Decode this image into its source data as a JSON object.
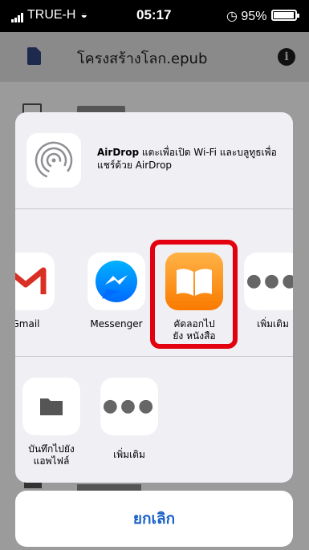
{
  "status_bar": {
    "carrier": "TRUE-H",
    "time": "05:17",
    "battery_percent": "95%",
    "battery_level": 0.95
  },
  "header": {
    "title": "โครงสร้างโลก.epub"
  },
  "airdrop": {
    "name": "AirDrop",
    "description": "แตะเพื่อเปิด Wi-Fi และบลูทูธเพื่อแชร์ด้วย AirDrop"
  },
  "share_apps": [
    {
      "label": "Gmail",
      "icon": "gmail-icon"
    },
    {
      "label": "Messenger",
      "icon": "messenger-icon"
    },
    {
      "label": "คัดลอกไปยัง หนังสือ",
      "label_line1": "คัดลอกไป",
      "label_line2": "ยัง หนังสือ",
      "icon": "books-icon"
    },
    {
      "label": "เพิ่มเติม",
      "icon": "more-icon"
    }
  ],
  "actions": [
    {
      "label_line1": "บันทึกไปยัง",
      "label_line2": "แอพไฟล์",
      "icon": "files-folder-icon"
    },
    {
      "label": "เพิ่มเติม",
      "icon": "more-icon"
    }
  ],
  "cancel_label": "ยกเลิก",
  "colors": {
    "highlight": "#e3000f",
    "cancel_text": "#1a61c8",
    "books": "#f97a00",
    "messenger": "#0084ff",
    "gmail_red": "#d93025"
  }
}
